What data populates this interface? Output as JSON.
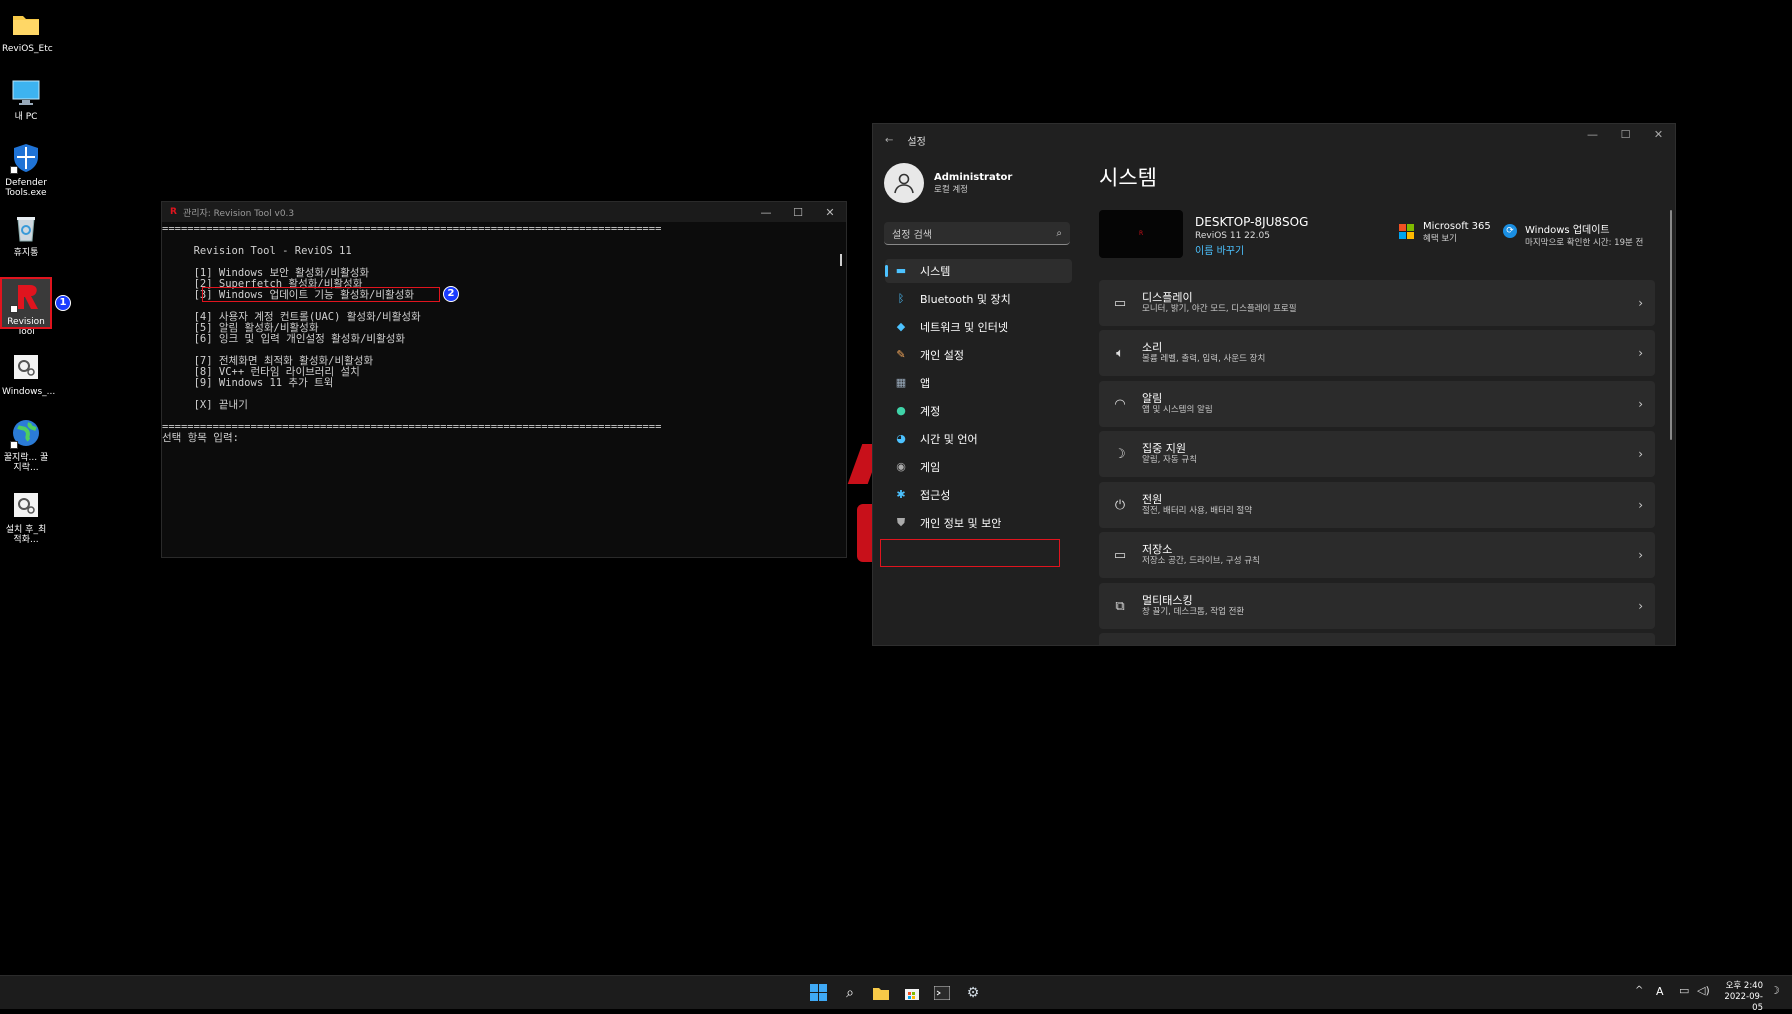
{
  "desktop": {
    "icons": [
      {
        "label": "ReviOS_Etc",
        "icon": "folder-icon"
      },
      {
        "label": "내 PC",
        "icon": "monitor-icon"
      },
      {
        "label": "Defender Tools.exe",
        "icon": "shield-icon"
      },
      {
        "label": "휴지통",
        "icon": "recycle-bin-icon"
      },
      {
        "label": "Revision Tool",
        "icon": "revision-r-icon"
      },
      {
        "label": "Windows_...",
        "icon": "gear-file-icon"
      },
      {
        "label": "꿀지락... 꿀지락...",
        "icon": "globe-icon"
      },
      {
        "label": "설치 후_최적화...",
        "icon": "gear-file-icon"
      }
    ],
    "step_badges": [
      "1",
      "2"
    ]
  },
  "terminal": {
    "title": "관리자: Revision Tool v0.3",
    "lines": [
      "===============================================================================",
      "",
      "     Revision Tool - ReviOS 11",
      "",
      "     [1] Windows 보안 활성화/비활성화",
      "     [2] Superfetch 활성화/비활성화",
      "     [3] Windows 업데이트 기능 활성화/비활성화",
      "",
      "     [4] 사용자 계정 컨트롤(UAC) 활성화/비활성화",
      "     [5] 알림 활성화/비활성화",
      "     [6] 잉크 및 입력 개인설정 활성화/비활성화",
      "",
      "     [7] 전체화면 최적화 활성화/비활성화",
      "     [8] VC++ 런타임 라이브러리 설치",
      "     [9] Windows 11 추가 트윅",
      "",
      "     [X] 끝내기",
      "",
      "===============================================================================",
      "선택 항목 입력:"
    ]
  },
  "settings": {
    "title": "설정",
    "user": {
      "name": "Administrator",
      "account": "로컬 계정"
    },
    "search_placeholder": "설정 검색",
    "nav": [
      {
        "label": "시스템",
        "icon": "monitor-icon",
        "color": "#4cc2ff"
      },
      {
        "label": "Bluetooth 및 장치",
        "icon": "bluetooth-icon",
        "color": "#4cc2ff"
      },
      {
        "label": "네트워크 및 인터넷",
        "icon": "wifi-icon",
        "color": "#4cc2ff"
      },
      {
        "label": "개인 설정",
        "icon": "brush-icon",
        "color": "#f2a65a"
      },
      {
        "label": "앱",
        "icon": "apps-icon",
        "color": "#9ab"
      },
      {
        "label": "계정",
        "icon": "person-icon",
        "color": "#3fd3a8"
      },
      {
        "label": "시간 및 언어",
        "icon": "globe-clock-icon",
        "color": "#4cc2ff"
      },
      {
        "label": "게임",
        "icon": "gamepad-icon",
        "color": "#aaa"
      },
      {
        "label": "접근성",
        "icon": "accessibility-icon",
        "color": "#4cc2ff"
      },
      {
        "label": "개인 정보 및 보안",
        "icon": "shield-icon",
        "color": "#aaa"
      }
    ],
    "page_title": "시스템",
    "device": {
      "name": "DESKTOP-8JU8SOG",
      "os": "ReviOS 11 22.05",
      "rename": "이름 바꾸기"
    },
    "ms365": {
      "title": "Microsoft 365",
      "sub": "혜택 보기"
    },
    "winupdate": {
      "title": "Windows 업데이트",
      "sub": "마지막으로 확인한 시간: 19분 전"
    },
    "rows": [
      {
        "title": "디스플레이",
        "sub": "모니터, 밝기, 야간 모드, 디스플레이 프로필",
        "icon": "display-icon"
      },
      {
        "title": "소리",
        "sub": "볼륨 레벨, 출력, 입력, 사운드 장치",
        "icon": "speaker-icon"
      },
      {
        "title": "알림",
        "sub": "앱 및 시스템의 알림",
        "icon": "bell-icon"
      },
      {
        "title": "집중 지원",
        "sub": "알림, 자동 규칙",
        "icon": "moon-icon"
      },
      {
        "title": "전원",
        "sub": "절전, 배터리 사용, 배터리 절약",
        "icon": "power-icon"
      },
      {
        "title": "저장소",
        "sub": "저장소 공간, 드라이브, 구성 규칙",
        "icon": "storage-icon"
      },
      {
        "title": "멀티태스킹",
        "sub": "창 끌기, 데스크톱, 작업 전환",
        "icon": "multitask-icon"
      }
    ]
  },
  "taskbar": {
    "icons": [
      "start-icon",
      "search-icon",
      "file-explorer-icon",
      "store-icon",
      "terminal-icon",
      "settings-icon"
    ],
    "tray": {
      "ime": "A",
      "time_period": "오후 2:40",
      "date": "2022-09-05"
    }
  },
  "colors": {
    "highlight": "#e0141e",
    "accent": "#4cc2ff",
    "badge": "#1a3cff"
  }
}
